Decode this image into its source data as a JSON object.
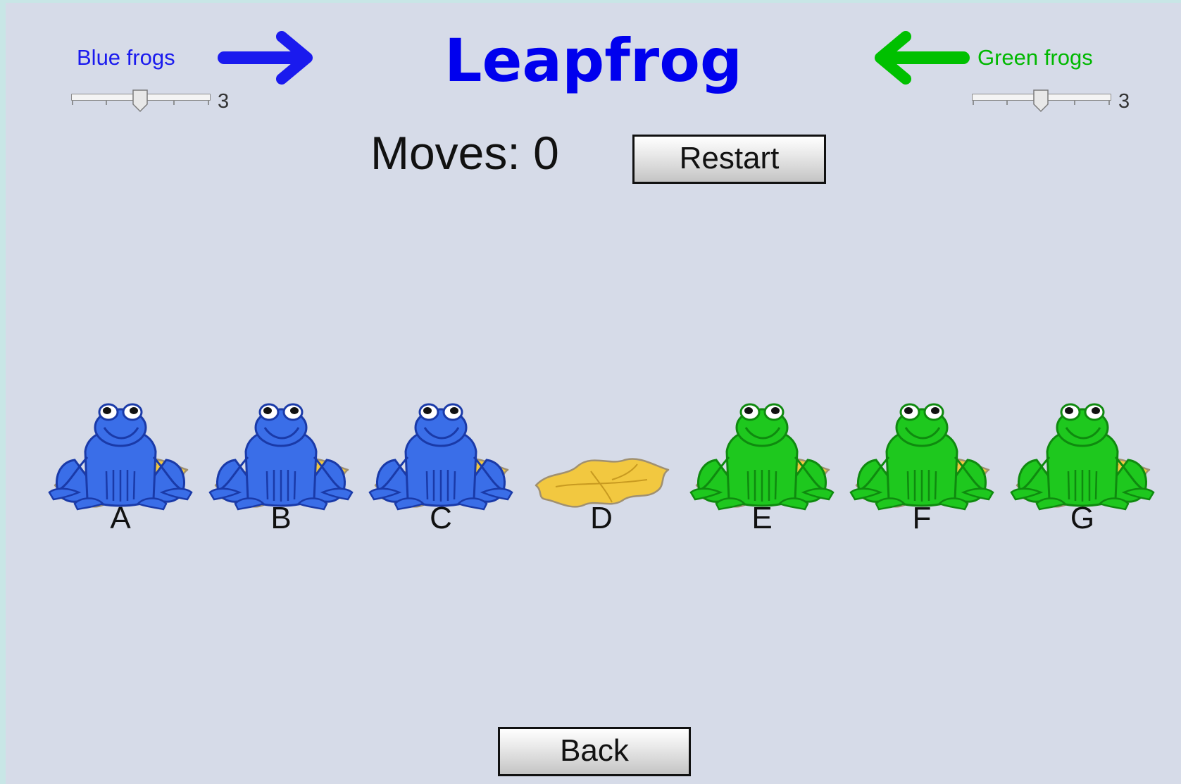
{
  "title": "Leapfrog",
  "blue": {
    "label": "Blue frogs",
    "count": "3",
    "color": "#1a1aee"
  },
  "green": {
    "label": "Green frogs",
    "count": "3",
    "color": "#00c000"
  },
  "moves": {
    "text": "Moves: 0"
  },
  "restart_label": "Restart",
  "back_label": "Back",
  "pads": [
    {
      "label": "A",
      "occupant": "blue"
    },
    {
      "label": "B",
      "occupant": "blue"
    },
    {
      "label": "C",
      "occupant": "blue"
    },
    {
      "label": "D",
      "occupant": "empty"
    },
    {
      "label": "E",
      "occupant": "green"
    },
    {
      "label": "F",
      "occupant": "green"
    },
    {
      "label": "G",
      "occupant": "green"
    }
  ]
}
